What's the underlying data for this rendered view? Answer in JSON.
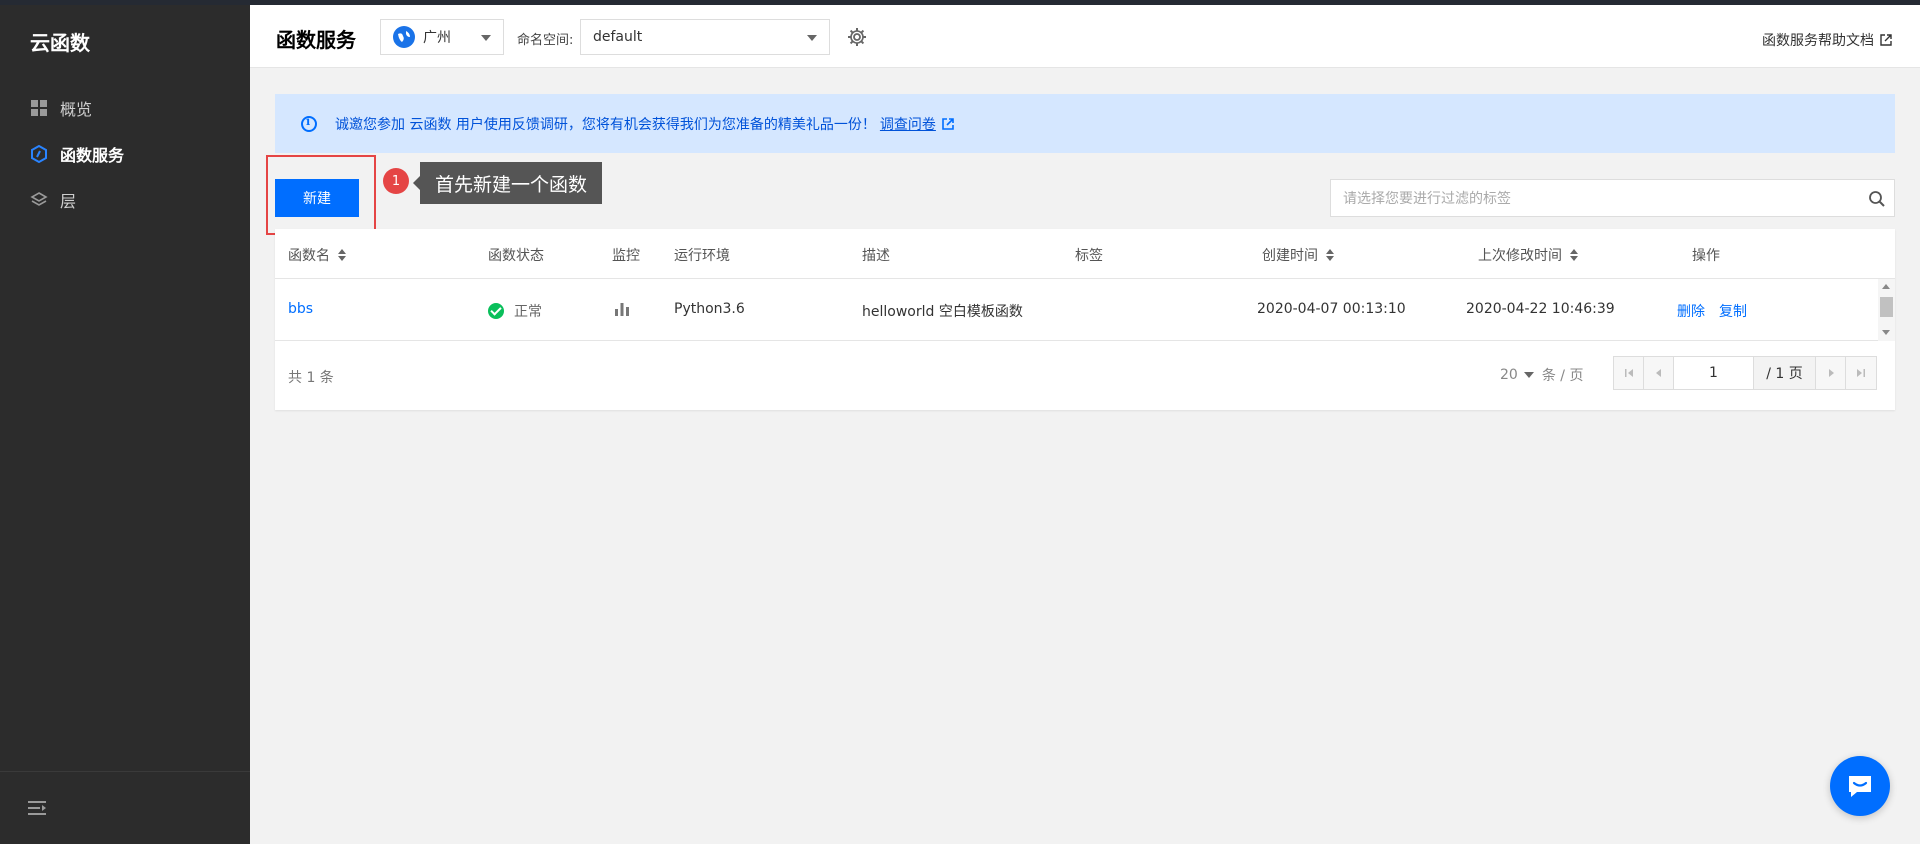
{
  "sidebar": {
    "brand": "云函数",
    "items": [
      {
        "label": "概览",
        "icon": "grid-icon"
      },
      {
        "label": "函数服务",
        "icon": "function-icon"
      },
      {
        "label": "层",
        "icon": "layers-icon"
      }
    ]
  },
  "header": {
    "title": "函数服务",
    "region": "广州",
    "namespace_label": "命名空间:",
    "namespace_value": "default",
    "help_link": "函数服务帮助文档"
  },
  "notice": {
    "text": "诚邀您参加 云函数 用户使用反馈调研，您将有机会获得我们为您准备的精美礼品一份！",
    "link": "调查问卷"
  },
  "toolbar": {
    "new_button": "新建",
    "step_number": "1",
    "tooltip": "首先新建一个函数",
    "search_placeholder": "请选择您要进行过滤的标签"
  },
  "table": {
    "columns": [
      "函数名",
      "函数状态",
      "监控",
      "运行环境",
      "描述",
      "标签",
      "创建时间",
      "上次修改时间",
      "操作"
    ],
    "rows": [
      {
        "name": "bbs",
        "status": "正常",
        "runtime": "Python3.6",
        "description": "helloworld 空白模板函数",
        "tags": "",
        "created": "2020-04-07 00:13:10",
        "modified": "2020-04-22 10:46:39",
        "actions": [
          "删除",
          "复制"
        ]
      }
    ],
    "footer": {
      "total": "共 1 条",
      "page_size": "20",
      "page_size_unit": "条 / 页",
      "current_page": "1",
      "total_pages": "/ 1 页"
    }
  },
  "colors": {
    "primary": "#006eff",
    "sidebar_bg": "#2c2c2c",
    "notice_bg": "#d5e7ff",
    "highlight": "#e54545",
    "success": "#0abf5b"
  }
}
